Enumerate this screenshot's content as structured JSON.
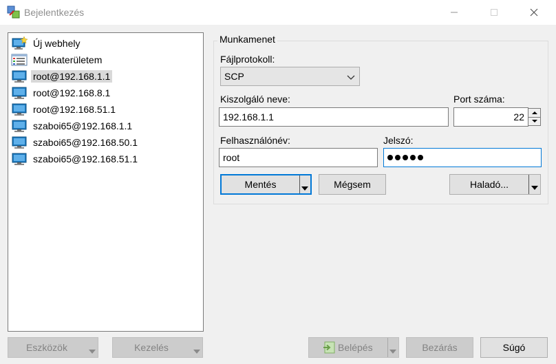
{
  "window": {
    "title": "Bejelentkezés"
  },
  "sites": [
    {
      "label": "Új webhely",
      "icon": "new-site-icon"
    },
    {
      "label": "Munkaterületem",
      "icon": "workspace-icon"
    },
    {
      "label": "root@192.168.1.1",
      "icon": "monitor-icon",
      "selected": true
    },
    {
      "label": "root@192.168.8.1",
      "icon": "monitor-icon"
    },
    {
      "label": "root@192.168.51.1",
      "icon": "monitor-icon"
    },
    {
      "label": "szaboi65@192.168.1.1",
      "icon": "monitor-icon"
    },
    {
      "label": "szaboi65@192.168.50.1",
      "icon": "monitor-icon"
    },
    {
      "label": "szaboi65@192.168.51.1",
      "icon": "monitor-icon"
    }
  ],
  "session": {
    "group_title": "Munkamenet",
    "protocol_label": "Fájlprotokoll:",
    "protocol_value": "SCP",
    "host_label": "Kiszolgáló neve:",
    "host_value": "192.168.1.1",
    "port_label": "Port száma:",
    "port_value": "22",
    "user_label": "Felhasználónév:",
    "user_value": "root",
    "password_label": "Jelszó:",
    "save_button": "Mentés",
    "cancel_button": "Mégsem",
    "advanced_button": "Haladó..."
  },
  "footer": {
    "tools_button": "Eszközök",
    "manage_button": "Kezelés",
    "login_button": "Belépés",
    "close_button": "Bezárás",
    "help_button": "Súgó"
  },
  "colors": {
    "accent": "#0078d7",
    "selection": "#d9d9d9",
    "monitor": "#1e7bc0"
  }
}
